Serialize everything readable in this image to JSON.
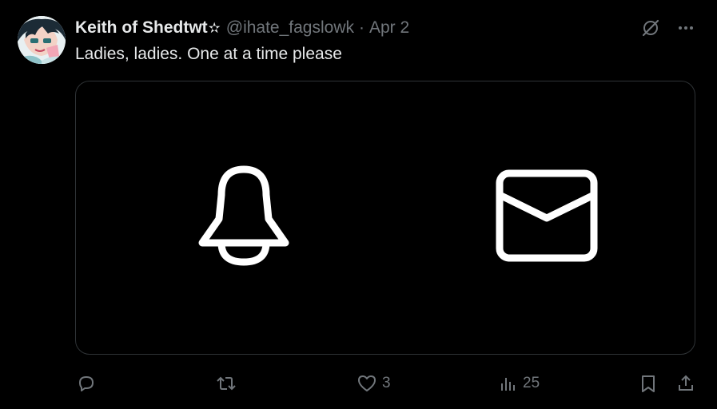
{
  "tweet": {
    "display_name": "Keith of Shedtwt",
    "badge_glyph": "✫",
    "handle": "@ihate_fagslowk",
    "separator": "·",
    "date": "Apr 2",
    "text": "Ladies, ladies. One at a time please"
  },
  "media": {
    "icons": [
      "bell-icon",
      "mail-icon"
    ]
  },
  "actions": {
    "reply_count": "",
    "repost_count": "",
    "like_count": "3",
    "views_count": "25"
  },
  "colors": {
    "background": "#000000",
    "text": "#e7e9ea",
    "muted": "#71767b",
    "border": "#2f3336"
  }
}
